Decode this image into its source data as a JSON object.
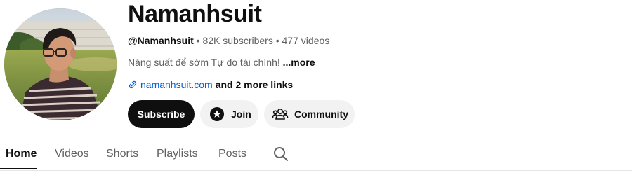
{
  "channel": {
    "name": "Namanhsuit",
    "handle": "@Namanhsuit",
    "subscribers": "82K subscribers",
    "videos": "477 videos",
    "separator": "•",
    "description": "Năng suất để sớm Tự do tài chính!",
    "more_label": "...more",
    "link_text": "namanhsuit.com",
    "more_links": "and 2 more links"
  },
  "actions": {
    "subscribe": "Subscribe",
    "join": "Join",
    "community": "Community"
  },
  "tabs": [
    {
      "label": "Home",
      "active": true
    },
    {
      "label": "Videos",
      "active": false
    },
    {
      "label": "Shorts",
      "active": false
    },
    {
      "label": "Playlists",
      "active": false
    },
    {
      "label": "Posts",
      "active": false
    }
  ],
  "icons": {
    "link": "link-icon",
    "join": "star-badge-icon",
    "community": "people-icon",
    "search": "search-icon"
  },
  "colors": {
    "subscribe_bg": "#0f0f0f",
    "chip_bg": "#f2f2f2",
    "link": "#065fd4",
    "secondary_text": "#606060"
  }
}
